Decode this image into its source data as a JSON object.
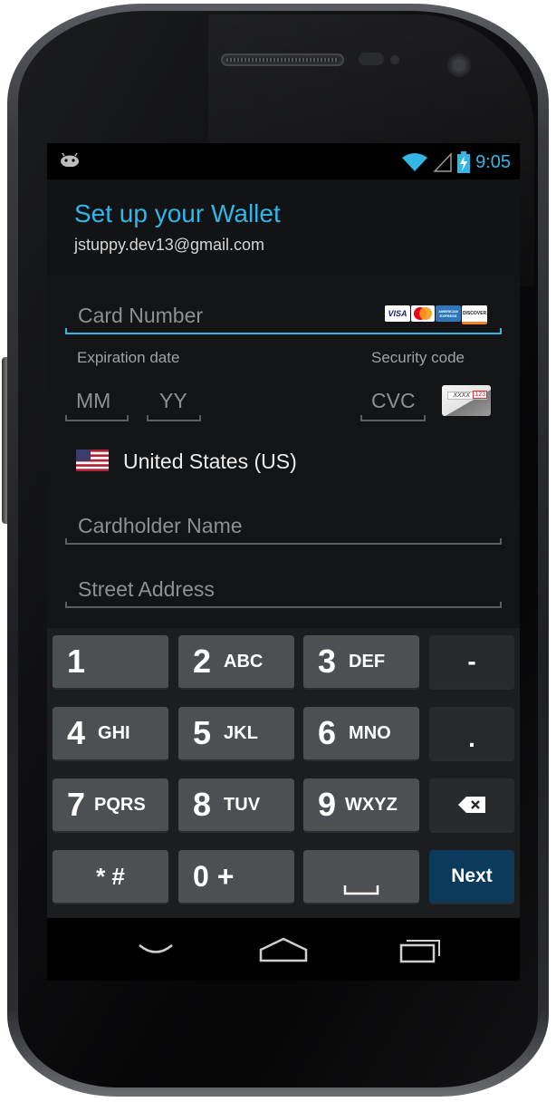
{
  "status_bar": {
    "time": "9:05",
    "icons": [
      "android-debug-icon",
      "wifi-icon",
      "signal-icon",
      "battery-charging-icon"
    ]
  },
  "header": {
    "title": "Set up your Wallet",
    "account": "jstuppy.dev13@gmail.com",
    "accent_color": "#33b5e5"
  },
  "form": {
    "card_number_placeholder": "Card Number",
    "card_brands": [
      "VISA",
      "MasterCard",
      "AMERICAN EXPRESS",
      "DISCOVER"
    ],
    "expiration_label": "Expiration date",
    "month_placeholder": "MM",
    "year_placeholder": "YY",
    "security_label": "Security code",
    "cvc_placeholder": "CVC",
    "cvc_card_sample": "XXXX",
    "cvc_card_number": "123",
    "country": "United States (US)",
    "cardholder_placeholder": "Cardholder Name",
    "street_placeholder": "Street Address"
  },
  "keyboard": {
    "rows": [
      [
        {
          "digit": "1",
          "letters": ""
        },
        {
          "digit": "2",
          "letters": "ABC"
        },
        {
          "digit": "3",
          "letters": "DEF"
        },
        {
          "symbol": "-"
        }
      ],
      [
        {
          "digit": "4",
          "letters": "GHI"
        },
        {
          "digit": "5",
          "letters": "JKL"
        },
        {
          "digit": "6",
          "letters": "MNO"
        },
        {
          "symbol": "."
        }
      ],
      [
        {
          "digit": "7",
          "letters": "PQRS"
        },
        {
          "digit": "8",
          "letters": "TUV"
        },
        {
          "digit": "9",
          "letters": "WXYZ"
        },
        {
          "symbol": "backspace-icon"
        }
      ],
      [
        {
          "digit": "* #",
          "letters": ""
        },
        {
          "digit": "0 +",
          "letters": ""
        },
        {
          "symbol": "space-icon"
        },
        {
          "label": "Next"
        }
      ]
    ],
    "next_color": "#0c3a5c"
  },
  "nav_bar": {
    "buttons": [
      "back-icon",
      "home-icon",
      "recent-apps-icon"
    ]
  }
}
